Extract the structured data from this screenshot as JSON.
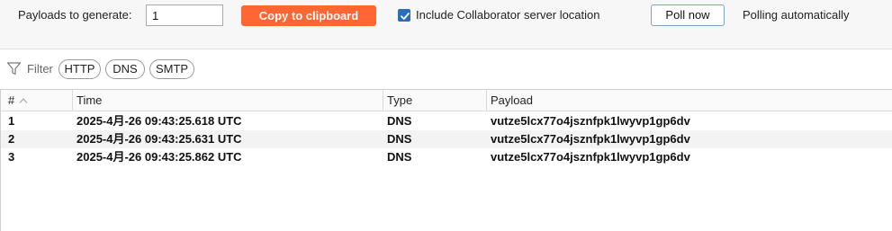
{
  "toolbar": {
    "payloads_label": "Payloads to generate:",
    "payloads_value": "1",
    "copy_label": "Copy to clipboard",
    "include_label": "Include Collaborator server location",
    "include_checked": true,
    "poll_label": "Poll now",
    "poll_status": "Polling automatically",
    "accent_color": "#ff6633"
  },
  "filter": {
    "label": "Filter",
    "icon": "funnel-icon",
    "chips": [
      "HTTP",
      "DNS",
      "SMTP"
    ]
  },
  "table": {
    "columns": [
      "#",
      "Time",
      "Type",
      "Payload"
    ],
    "sort_icon": "chevron-up-icon",
    "rows": [
      {
        "num": "1",
        "time": "2025-4月-26 09:43:25.618 UTC",
        "type": "DNS",
        "payload": "vutze5lcx77o4jsznfpk1lwyvp1gp6dv"
      },
      {
        "num": "2",
        "time": "2025-4月-26 09:43:25.631 UTC",
        "type": "DNS",
        "payload": "vutze5lcx77o4jsznfpk1lwyvp1gp6dv"
      },
      {
        "num": "3",
        "time": "2025-4月-26 09:43:25.862 UTC",
        "type": "DNS",
        "payload": "vutze5lcx77o4jsznfpk1lwyvp1gp6dv"
      }
    ]
  }
}
